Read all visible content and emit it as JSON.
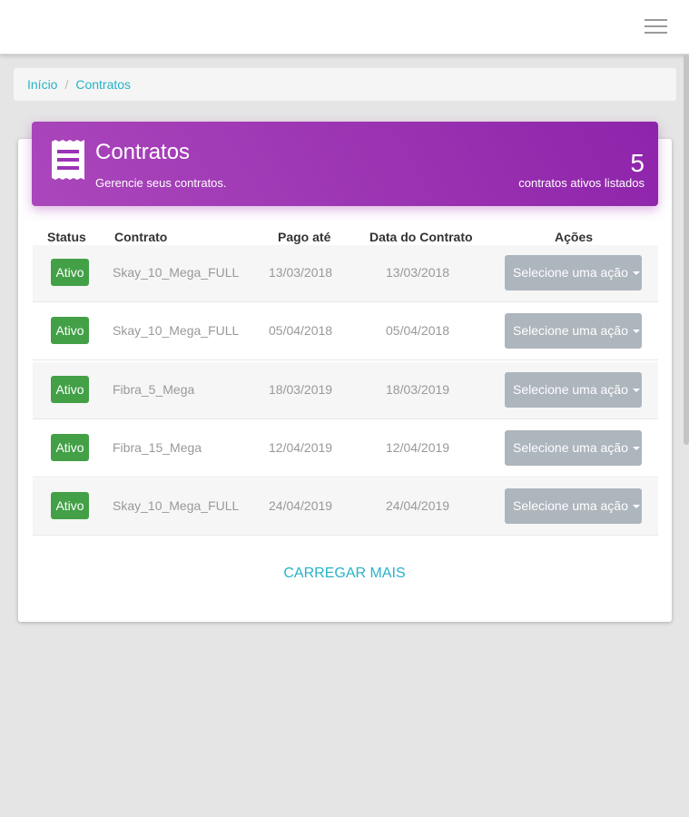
{
  "breadcrumb": {
    "home": "Início",
    "separator": "/",
    "current": "Contratos"
  },
  "header": {
    "title": "Contratos",
    "subtitle": "Gerencie seus contratos.",
    "count": "5",
    "count_label": "contratos ativos listados",
    "gradient_start": "#ab47bc",
    "gradient_end": "#8e24aa"
  },
  "table": {
    "columns": [
      "Status",
      "Contrato",
      "Pago até",
      "Data do Contrato",
      "Ações"
    ],
    "rows": [
      {
        "status": "Ativo",
        "contract": "Skay_10_Mega_FULL",
        "paid_until": "13/03/2018",
        "contract_date": "13/03/2018",
        "action": "Selecione uma ação"
      },
      {
        "status": "Ativo",
        "contract": "Skay_10_Mega_FULL",
        "paid_until": "05/04/2018",
        "contract_date": "05/04/2018",
        "action": "Selecione uma ação"
      },
      {
        "status": "Ativo",
        "contract": "Fibra_5_Mega",
        "paid_until": "18/03/2019",
        "contract_date": "18/03/2019",
        "action": "Selecione uma ação"
      },
      {
        "status": "Ativo",
        "contract": "Fibra_15_Mega",
        "paid_until": "12/04/2019",
        "contract_date": "12/04/2019",
        "action": "Selecione uma ação"
      },
      {
        "status": "Ativo",
        "contract": "Skay_10_Mega_FULL",
        "paid_until": "24/04/2019",
        "contract_date": "24/04/2019",
        "action": "Selecione uma ação"
      }
    ]
  },
  "load_more": "CARREGAR MAIS",
  "colors": {
    "accent": "#27b3c8",
    "status_active": "#43a047",
    "action_button": "#adb5bd"
  }
}
